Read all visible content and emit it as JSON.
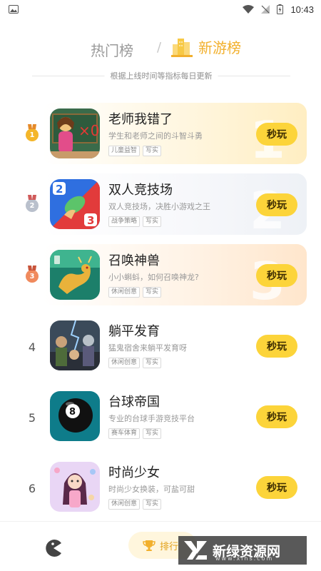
{
  "status": {
    "time": "10:43",
    "image_icon": "image-icon",
    "wifi_icon": "wifi-icon",
    "signal_icon": "no-signal-icon",
    "battery_icon": "battery-charging-icon"
  },
  "header": {
    "tab_hot": "热门榜",
    "separator": "/",
    "tab_new": "新游榜",
    "accent": "#f2b02d"
  },
  "subtitle": "根据上线时间等指标每日更新",
  "games": [
    {
      "rank": "1",
      "medal": "gold",
      "title": "老师我错了",
      "desc": "学生和老师之间的斗智斗勇",
      "tags": [
        "儿童益智",
        "写实"
      ],
      "button": "秒玩"
    },
    {
      "rank": "2",
      "medal": "silver",
      "title": "双人竞技场",
      "desc": "双人竞技场，决胜小游戏之王",
      "tags": [
        "战争策略",
        "写实"
      ],
      "button": "秒玩"
    },
    {
      "rank": "3",
      "medal": "bronze",
      "title": "召唤神兽",
      "desc": "小小蝌蚪，如何召唤神龙?",
      "tags": [
        "休闲创意",
        "写实"
      ],
      "button": "秒玩"
    },
    {
      "rank": "4",
      "medal": "",
      "title": "躺平发育",
      "desc": "猛鬼宿舍来躺平发育呀",
      "tags": [
        "休闲创意",
        "写实"
      ],
      "button": "秒玩"
    },
    {
      "rank": "5",
      "medal": "",
      "title": "台球帝国",
      "desc": "专业的台球手游竞技平台",
      "tags": [
        "赛车体育",
        "写实"
      ],
      "button": "秒玩"
    },
    {
      "rank": "6",
      "medal": "",
      "title": "时尚少女",
      "desc": "时尚少女换装，可盐可甜",
      "tags": [
        "休闲创意",
        "写实"
      ],
      "button": "秒玩"
    }
  ],
  "bottom_bar": {
    "game_icon": "pacman-icon",
    "rank_label": "排行",
    "rank_icon": "trophy-icon"
  },
  "watermark": {
    "text": "新绿资源网",
    "sub": "www.xlhs.com"
  }
}
